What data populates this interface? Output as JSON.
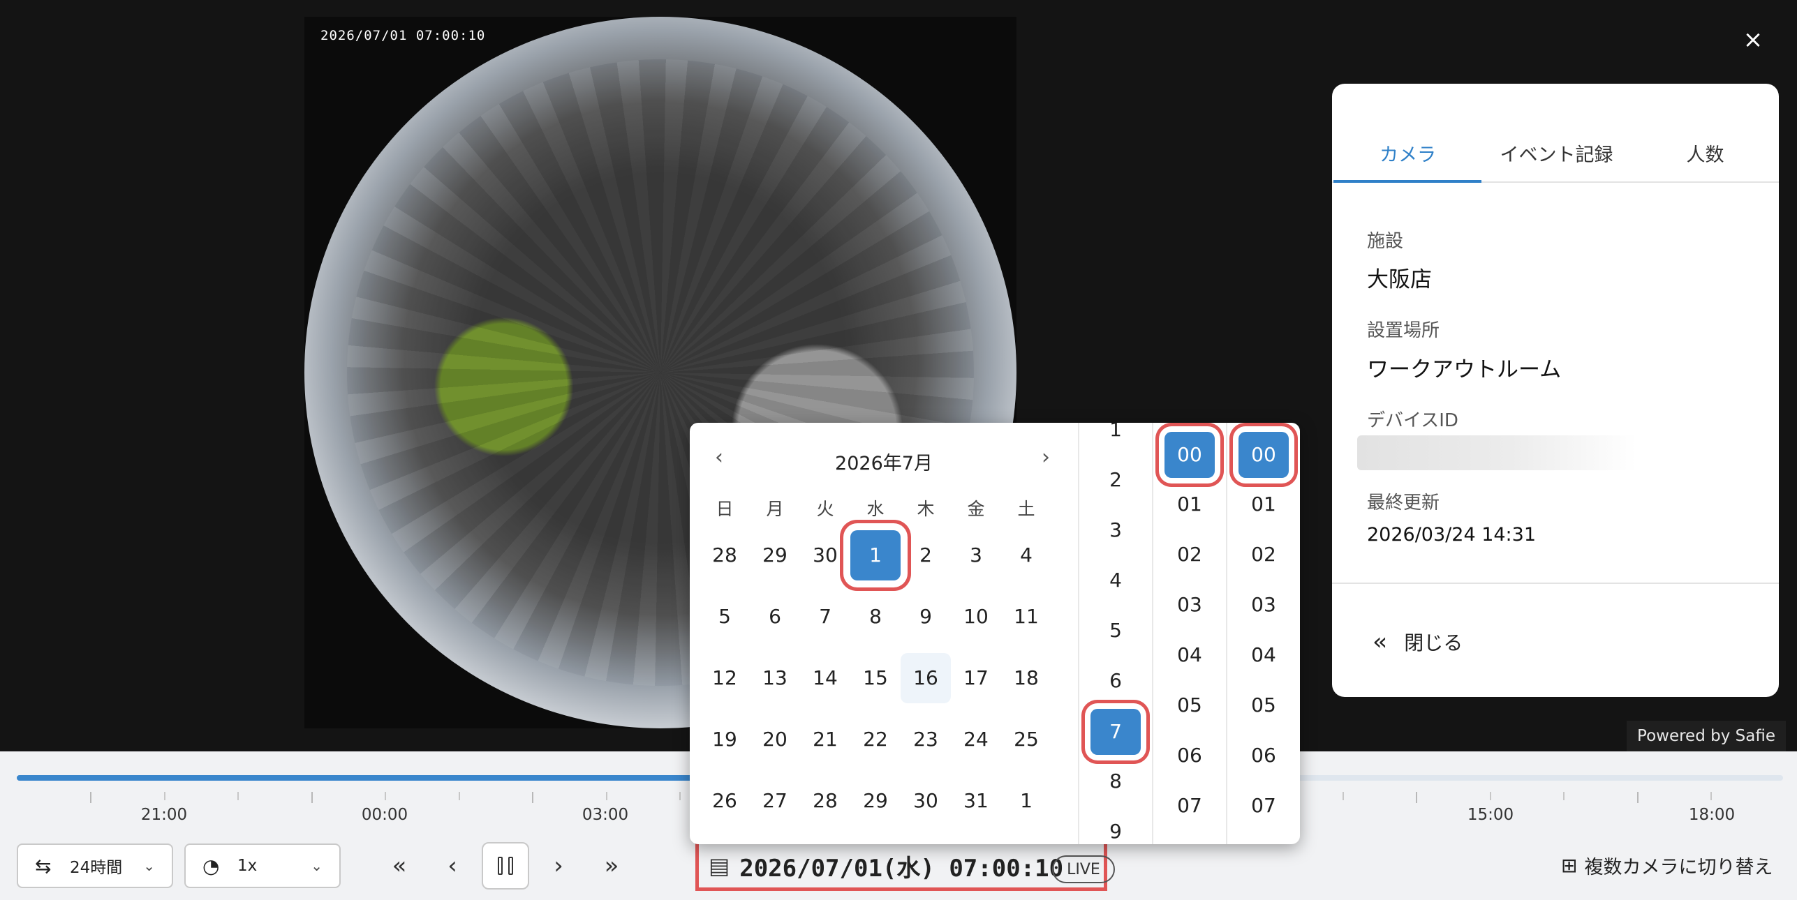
{
  "video": {
    "timestamp": "2026/07/01 07:00:10"
  },
  "panel": {
    "tabs": [
      {
        "label": "カメラ"
      },
      {
        "label": "イベント記録"
      },
      {
        "label": "人数"
      }
    ],
    "fields": {
      "facility_label": "施設",
      "facility_value": "大阪店",
      "location_label": "設置場所",
      "location_value": "ワークアウトルーム",
      "device_label": "デバイスID",
      "updated_label": "最終更新",
      "updated_value": "2026/03/24 14:31"
    },
    "close_label": "閉じる"
  },
  "powered_by": "Powered by Safie",
  "timeline": {
    "progress_fraction": 0.4,
    "labels": [
      "21:00",
      "00:00",
      "03:00",
      "15:00",
      "18:00"
    ]
  },
  "controls": {
    "range_label": "24時間",
    "speed_label": "1x",
    "datetime": "2026/07/01(水) 07:00:10",
    "live_label": "LIVE",
    "multi_camera_label": "複数カメラに切り替え"
  },
  "picker": {
    "month_title": "2026年7月",
    "weekdays": [
      "日",
      "月",
      "火",
      "水",
      "木",
      "金",
      "土"
    ],
    "weeks": [
      [
        "28",
        "29",
        "30",
        "1",
        "2",
        "3",
        "4"
      ],
      [
        "5",
        "6",
        "7",
        "8",
        "9",
        "10",
        "11"
      ],
      [
        "12",
        "13",
        "14",
        "15",
        "16",
        "17",
        "18"
      ],
      [
        "19",
        "20",
        "21",
        "22",
        "23",
        "24",
        "25"
      ],
      [
        "26",
        "27",
        "28",
        "29",
        "30",
        "31",
        "1"
      ]
    ],
    "selected_day": "1",
    "today_day": "16",
    "hours": [
      "1",
      "2",
      "3",
      "4",
      "5",
      "6",
      "7",
      "8",
      "9"
    ],
    "selected_hour": "7",
    "minutes": [
      "00",
      "01",
      "02",
      "03",
      "04",
      "05",
      "06",
      "07"
    ],
    "selected_minute": "00",
    "seconds": [
      "00",
      "01",
      "02",
      "03",
      "04",
      "05",
      "06",
      "07"
    ],
    "selected_second": "00"
  },
  "colors": {
    "accent": "#3a86cc",
    "highlight_box": "#e05555"
  },
  "icons": {
    "close": "close-icon",
    "range": "swap-arrows-icon",
    "speed": "gauge-icon",
    "calendar": "calendar-icon",
    "grid": "grid-icon"
  }
}
